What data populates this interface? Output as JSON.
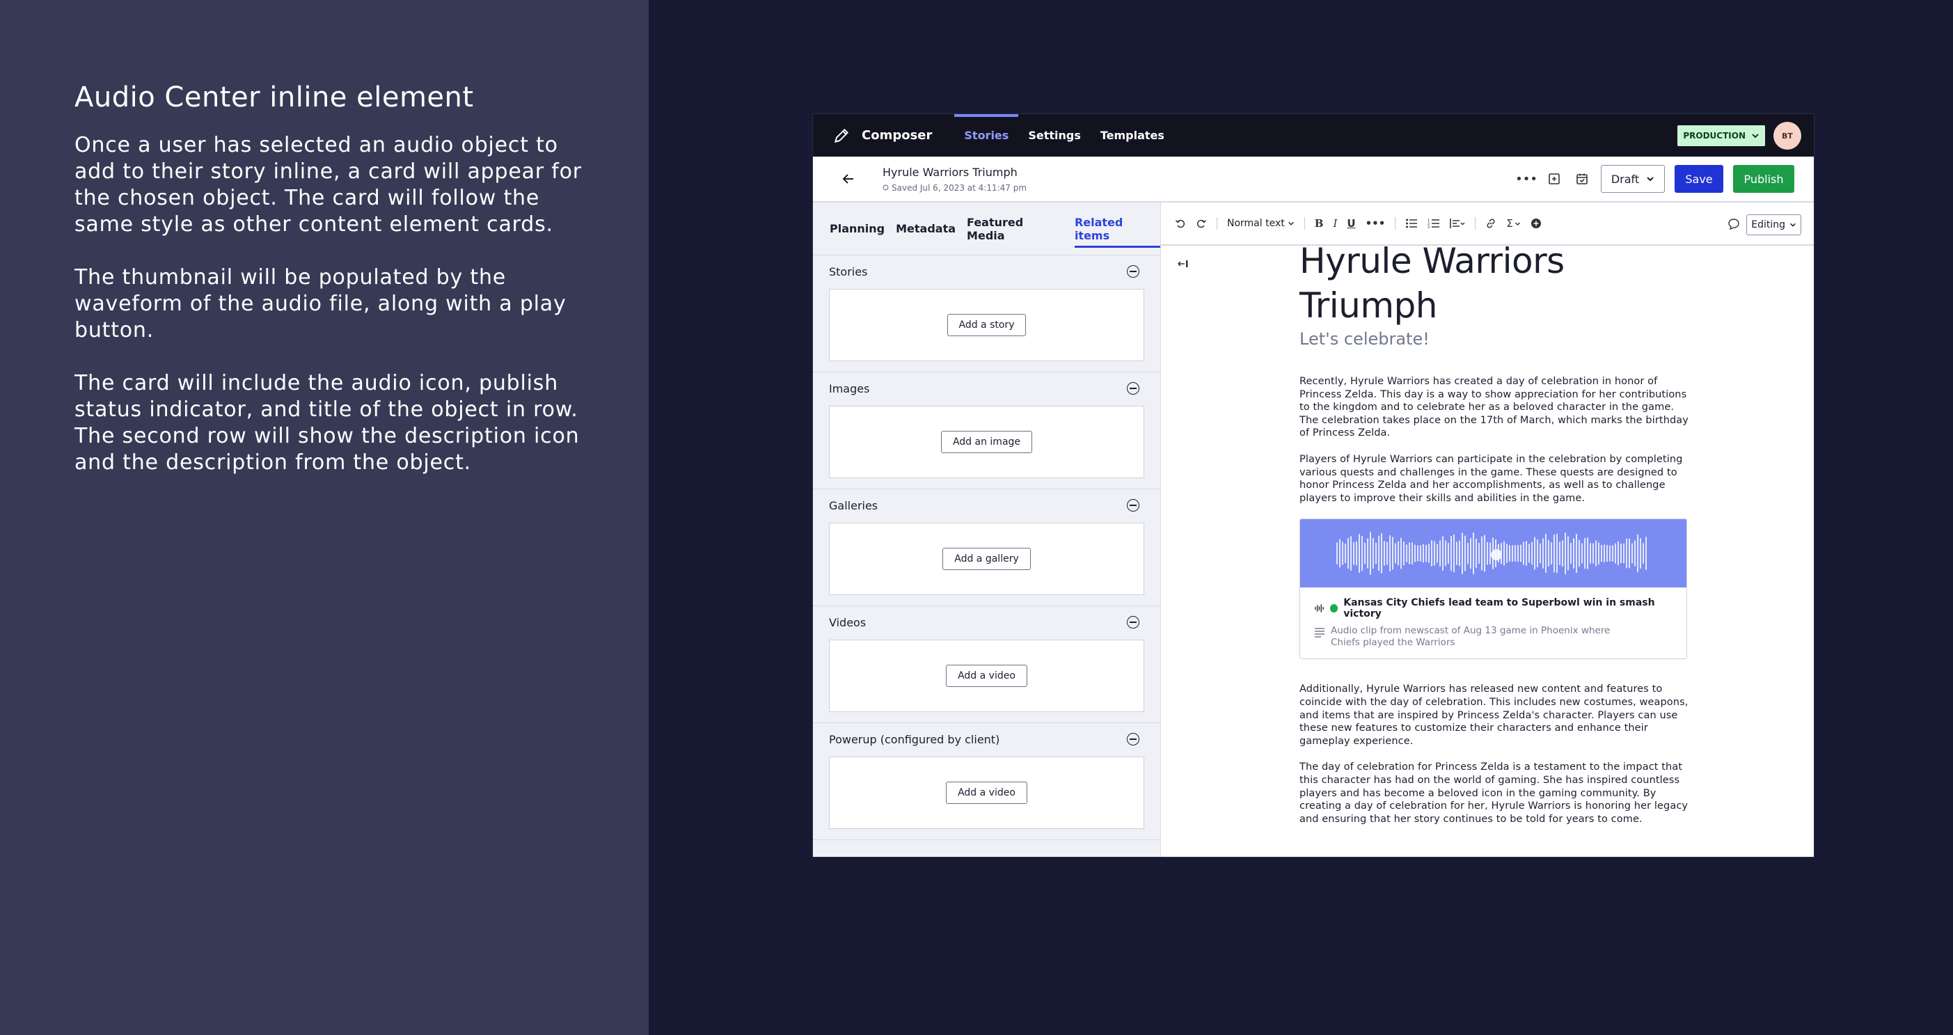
{
  "description": {
    "title": "Audio Center inline element",
    "paragraphs": [
      "Once a user has selected an audio object to add to their story inline, a card will appear for the chosen object. The card will follow the same style as other content element cards.",
      "The thumbnail will be populated by the waveform of the audio file, along with a play button.",
      "The card will include the audio icon, publish status indicator, and title of the object in row. The second row will show the description icon and the description from the object."
    ]
  },
  "topnav": {
    "brand": "Composer",
    "tabs": [
      "Stories",
      "Settings",
      "Templates"
    ],
    "active_tab": "Stories",
    "environment": "PRODUCTION",
    "avatar_initials": "BT"
  },
  "storybar": {
    "story_title": "Hyrule Warriors Triumph",
    "saved_text": "Saved Jul 6, 2023 at 4:11:47 pm",
    "status": "Draft",
    "save_label": "Save",
    "publish_label": "Publish"
  },
  "sidepanel": {
    "tabs": [
      "Planning",
      "Metadata",
      "Featured Media",
      "Related items"
    ],
    "active_tab": "Related items",
    "sections": [
      {
        "title": "Stories",
        "button": "Add a story"
      },
      {
        "title": "Images",
        "button": "Add an image"
      },
      {
        "title": "Galleries",
        "button": "Add a gallery"
      },
      {
        "title": "Videos",
        "button": "Add a video"
      },
      {
        "title": "Powerup (configured by client)",
        "button": "Add a video"
      }
    ]
  },
  "toolbar": {
    "text_style": "Normal text",
    "mode": "Editing"
  },
  "article": {
    "title": "Hyrule Warriors Triumph",
    "subtitle": "Let's celebrate!",
    "paragraphs_before": [
      "Recently, Hyrule Warriors has created a day of celebration in honor of Princess Zelda. This day is a way to show appreciation for her contributions to the kingdom and to celebrate her as a beloved character in the game. The celebration takes place on the 17th of March, which marks the birthday of Princess Zelda.",
      "Players of Hyrule Warriors can participate in the celebration by completing various quests and challenges in the game. These quests are designed to honor Princess Zelda and her accomplishments, as well as to challenge players to improve their skills and abilities in the game."
    ],
    "audio_card": {
      "title": "Kansas City Chiefs lead team to Superbowl win in smash victory",
      "description": "Audio clip from newscast of Aug 13 game in Phoenix where Chiefs played the Warriors",
      "thumb_color": "#7a8cf2",
      "status_color": "#1fa84b"
    },
    "paragraphs_after": [
      "Additionally, Hyrule Warriors has released new content and features to coincide with the day of celebration. This includes new costumes, weapons, and items that are inspired by Princess Zelda's character. Players can use these new features to customize their characters and enhance their gameplay experience.",
      "The day of celebration for Princess Zelda is a testament to the impact that this character has had on the world of gaming. She has inspired countless players and has become a beloved icon in the gaming community. By creating a day of celebration for her, Hyrule Warriors is honoring her legacy and ensuring that her story continues to be told for years to come."
    ]
  }
}
